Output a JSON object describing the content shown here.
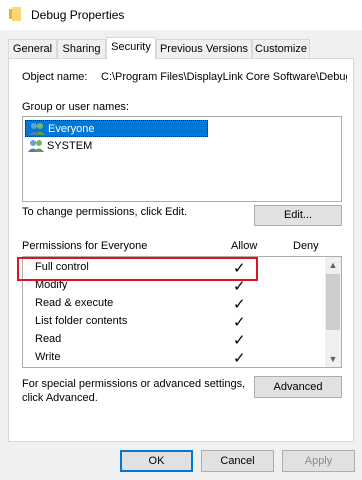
{
  "window": {
    "title": "Debug Properties",
    "icon": "folder-icon"
  },
  "tabs": [
    {
      "label": "General"
    },
    {
      "label": "Sharing"
    },
    {
      "label": "Security",
      "active": true
    },
    {
      "label": "Previous Versions"
    },
    {
      "label": "Customize"
    }
  ],
  "security": {
    "object_label": "Object name:",
    "object_path": "C:\\Program Files\\DisplayLink Core Software\\Debug",
    "group_label": "Group or user names:",
    "users": [
      {
        "name": "Everyone",
        "selected": true,
        "icon": "users-icon"
      },
      {
        "name": "SYSTEM",
        "selected": false,
        "icon": "users-icon"
      }
    ],
    "change_text": "To change permissions, click Edit.",
    "edit_label": "Edit...",
    "perm_label": "Permissions for Everyone",
    "allow_label": "Allow",
    "deny_label": "Deny",
    "permissions": [
      {
        "name": "Full control",
        "allow": "✓",
        "deny": ""
      },
      {
        "name": "Modify",
        "allow": "✓",
        "deny": ""
      },
      {
        "name": "Read & execute",
        "allow": "✓",
        "deny": ""
      },
      {
        "name": "List folder contents",
        "allow": "✓",
        "deny": ""
      },
      {
        "name": "Read",
        "allow": "✓",
        "deny": ""
      },
      {
        "name": "Write",
        "allow": "✓",
        "deny": ""
      }
    ],
    "special_text_line1": "For special permissions or advanced settings,",
    "special_text_line2": "click Advanced.",
    "advanced_label": "Advanced"
  },
  "footer": {
    "ok_label": "OK",
    "cancel_label": "Cancel",
    "apply_label": "Apply"
  },
  "colors": {
    "selection": "#0078d7",
    "highlight_box": "#e0141e"
  }
}
